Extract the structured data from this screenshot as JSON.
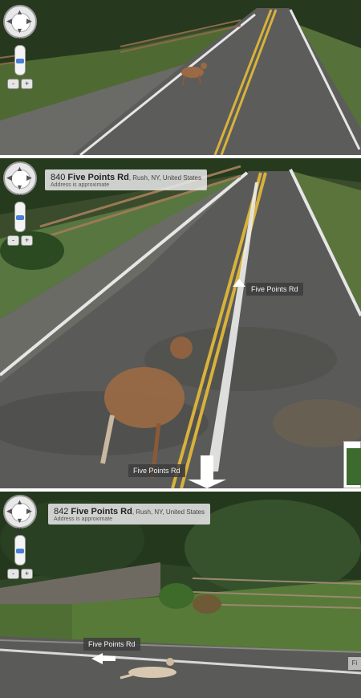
{
  "panel_1": {
    "compass_label": "N",
    "zoom_in_label": "+",
    "zoom_out_label": "-"
  },
  "panel_2": {
    "address_number": "840",
    "address_street": "Five Points Rd",
    "address_locality": ", Rush, NY, United States",
    "address_note": "Address is approximate",
    "compass_label": "N",
    "zoom_in_label": "+",
    "zoom_out_label": "-",
    "road_label_ahead": "Five Points Rd",
    "road_label_back": "Five Points Rd"
  },
  "panel_3": {
    "address_number": "842",
    "address_street": "Five Points Rd",
    "address_locality": ", Rush, NY, United States",
    "address_note": "Address is approximate",
    "compass_label": "N",
    "zoom_in_label": "+",
    "zoom_out_label": "-",
    "road_label": "Five Points Rd",
    "edge_label": "Fi"
  },
  "colors": {
    "asphalt": "#5a5a58",
    "yellow_line": "#d8b23a",
    "white_line": "#e6e6e6",
    "grass": "#5e7a3a",
    "trees": "#2e4424",
    "deer": "#9b6a44"
  },
  "icons": {
    "nav_control": "pan-compass-icon",
    "zoom_slider": "zoom-slider-icon",
    "nav_arrow": "street-arrow-icon"
  }
}
